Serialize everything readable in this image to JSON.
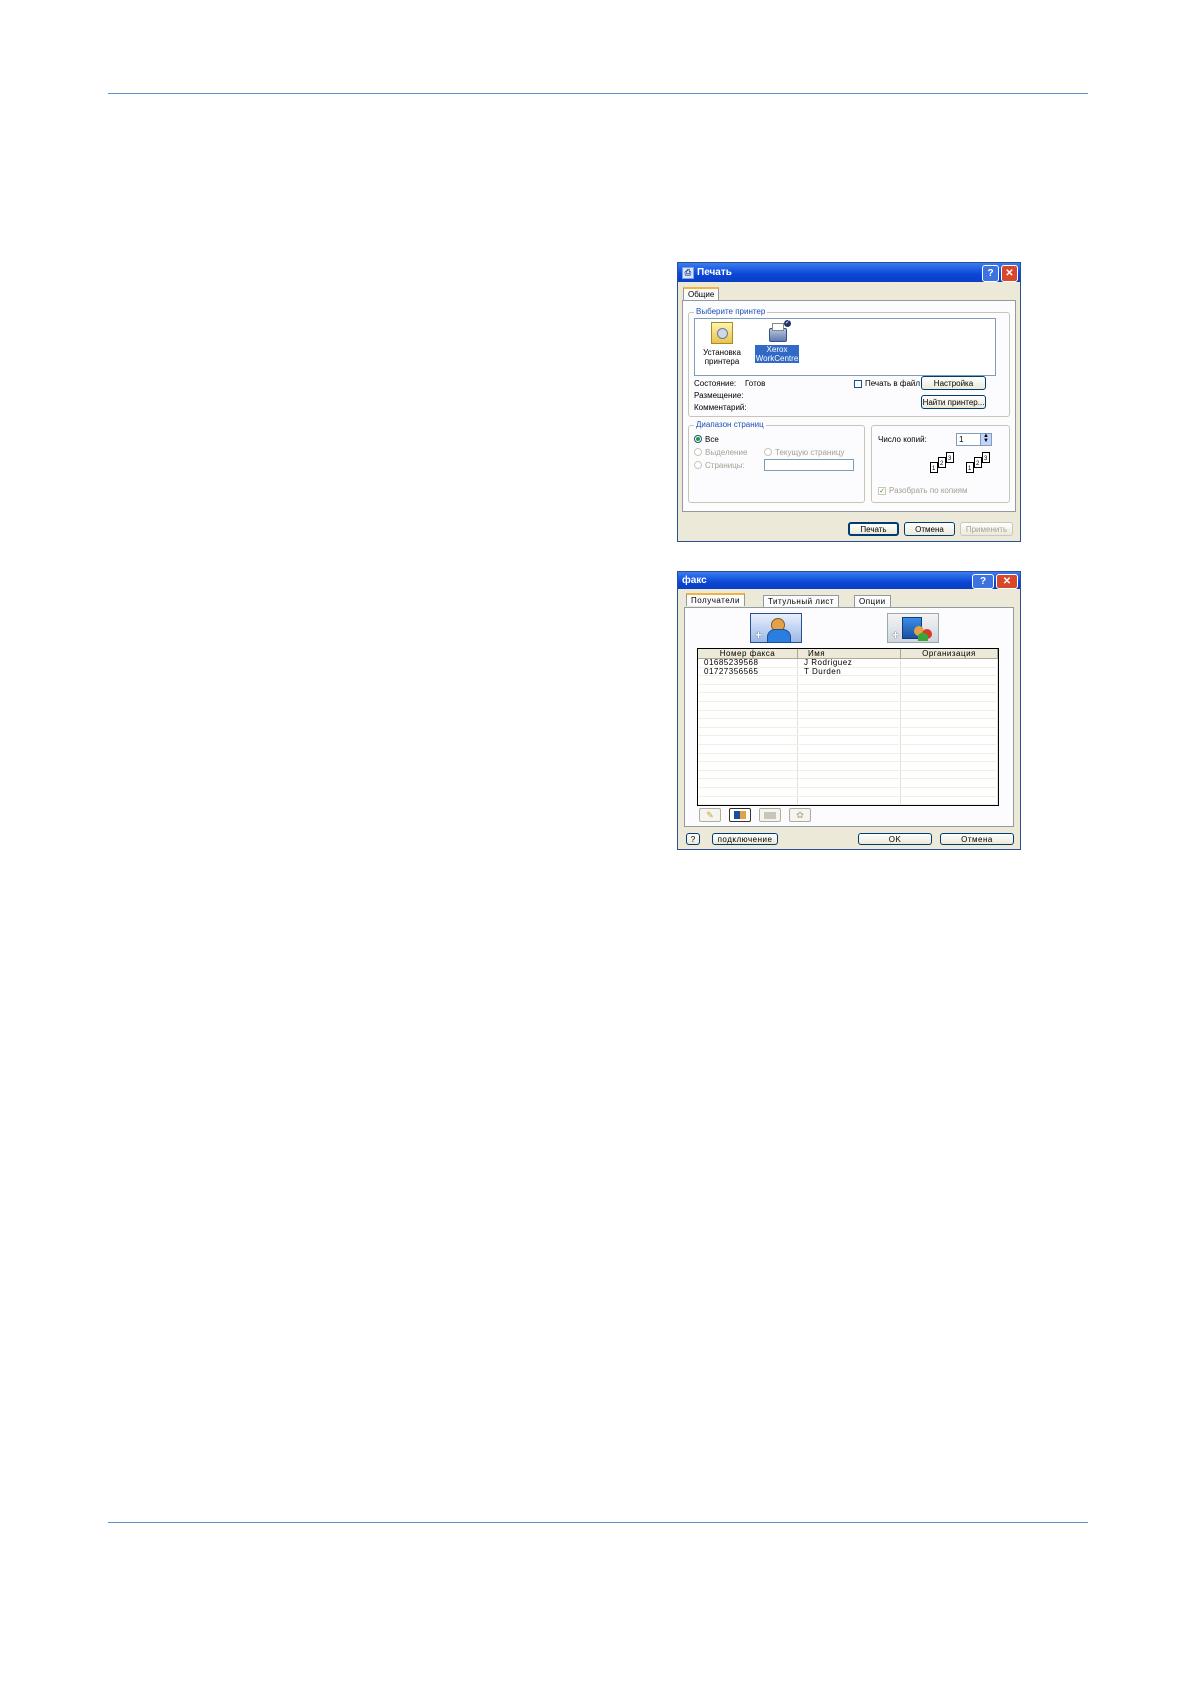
{
  "print_dialog": {
    "title": "Печать",
    "tab": "Общие",
    "select_printer_legend": "Выберите принтер",
    "printers": [
      {
        "label_line1": "Установка",
        "label_line2": "принтера",
        "icon": "add-printer-icon",
        "selected": false
      },
      {
        "label_line1": "Xerox",
        "label_line2": "WorkCentre",
        "icon": "printer-icon",
        "selected": true
      }
    ],
    "status_label": "Состояние:",
    "status_value": "Готов",
    "location_label": "Размещение:",
    "comment_label": "Комментарий:",
    "print_to_file": "Печать в файл",
    "settings_button": "Настройка",
    "find_printer_button": "Найти принтер...",
    "page_range_legend": "Диапазон страниц",
    "range_all": "Все",
    "range_selection": "Выделение",
    "range_current": "Текущую страницу",
    "range_pages": "Страницы:",
    "copies_label": "Число копий:",
    "copies_value": "1",
    "collate_label": "Разобрать по копиям",
    "print_button": "Печать",
    "cancel_button": "Отмена",
    "apply_button": "Применить"
  },
  "fax_dialog": {
    "title": "факс",
    "tabs": [
      "Получатели",
      "Титульный лист",
      "Опции"
    ],
    "columns": [
      "Номер факса",
      "Имя",
      "Организация"
    ],
    "rows": [
      [
        "01685239568",
        "J Rodriguez",
        ""
      ],
      [
        "01727356565",
        "T Durden",
        ""
      ]
    ],
    "help_button": "?",
    "connection_button": "подключение",
    "ok_button": "OK",
    "cancel_button": "Отмена"
  },
  "colors": {
    "rule": "#5b8fc7",
    "title_bar": "#0a46d6",
    "dialog_bg": "#ece9d8"
  }
}
